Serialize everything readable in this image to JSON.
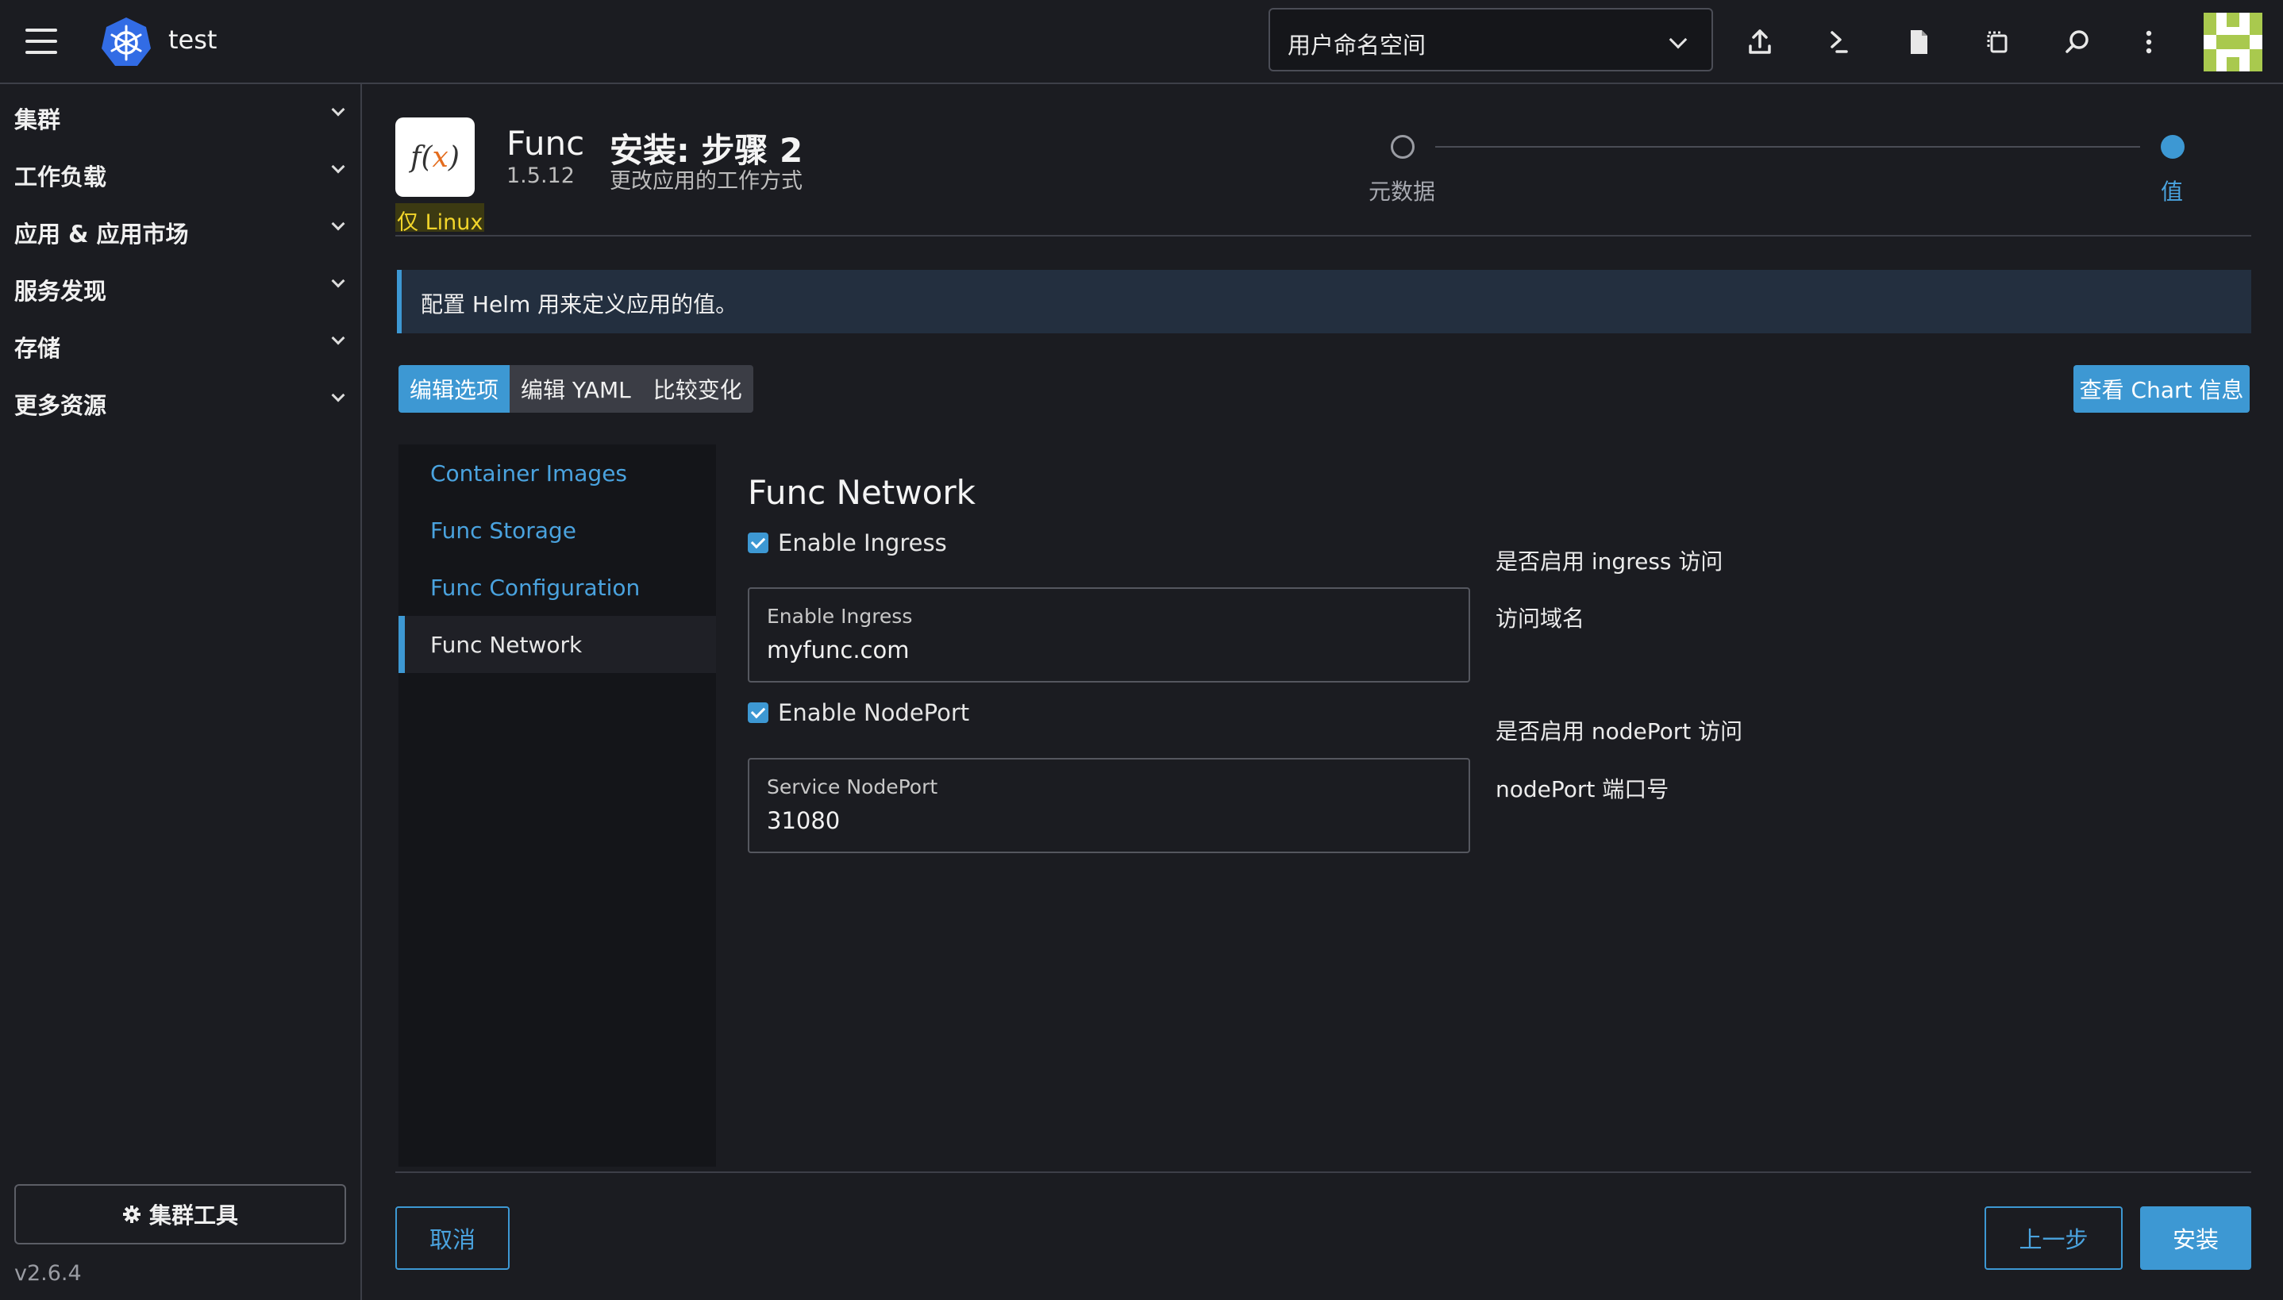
{
  "header": {
    "cluster_name": "test",
    "namespace_select": "用户命名空间",
    "icons": [
      "menu-icon",
      "kubernetes-logo",
      "upload-icon",
      "terminal-icon",
      "file-icon",
      "copy-icon",
      "search-icon",
      "more-vert-icon",
      "user-avatar"
    ]
  },
  "sidebar": {
    "items": [
      {
        "label": "集群"
      },
      {
        "label": "工作负载"
      },
      {
        "label": "应用 & 应用市场"
      },
      {
        "label": "服务发现"
      },
      {
        "label": "存储"
      },
      {
        "label": "更多资源"
      }
    ],
    "cluster_tools": "集群工具",
    "version": "v2.6.4"
  },
  "app": {
    "logo_text": "f(x)",
    "name": "Func",
    "version": "1.5.12",
    "os_badge": "仅 Linux",
    "step_title": "安装: 步骤 2",
    "step_subtitle": "更改应用的工作方式"
  },
  "stepper": {
    "steps": [
      {
        "label": "元数据",
        "state": "done"
      },
      {
        "label": "值",
        "state": "active"
      }
    ]
  },
  "banner": {
    "text": "配置 Helm 用来定义应用的值。"
  },
  "tabs": {
    "items": [
      {
        "label": "编辑选项",
        "active": true
      },
      {
        "label": "编辑 YAML",
        "active": false
      },
      {
        "label": "比较变化",
        "active": false
      }
    ],
    "chart_info_button": "查看 Chart 信息"
  },
  "side_nav": {
    "items": [
      {
        "label": "Container Images",
        "active": false
      },
      {
        "label": "Func Storage",
        "active": false
      },
      {
        "label": "Func Configuration",
        "active": false
      },
      {
        "label": "Func Network",
        "active": true
      }
    ]
  },
  "form": {
    "title": "Func Network",
    "enable_ingress": {
      "label": "Enable Ingress",
      "checked": true,
      "description": "是否启用 ingress 访问"
    },
    "ingress_host": {
      "label": "Enable Ingress",
      "value": "myfunc.com",
      "description": "访问域名"
    },
    "enable_nodeport": {
      "label": "Enable NodePort",
      "checked": true,
      "description": "是否启用 nodePort 访问"
    },
    "service_nodeport": {
      "label": "Service NodePort",
      "value": "31080",
      "description": "nodePort 端口号"
    }
  },
  "footer": {
    "cancel": "取消",
    "previous": "上一步",
    "install": "安装"
  },
  "colors": {
    "accent": "#3d98d3",
    "background": "#1b1c21",
    "banner": "#232f3f",
    "linux_badge": "#f2d52a"
  }
}
